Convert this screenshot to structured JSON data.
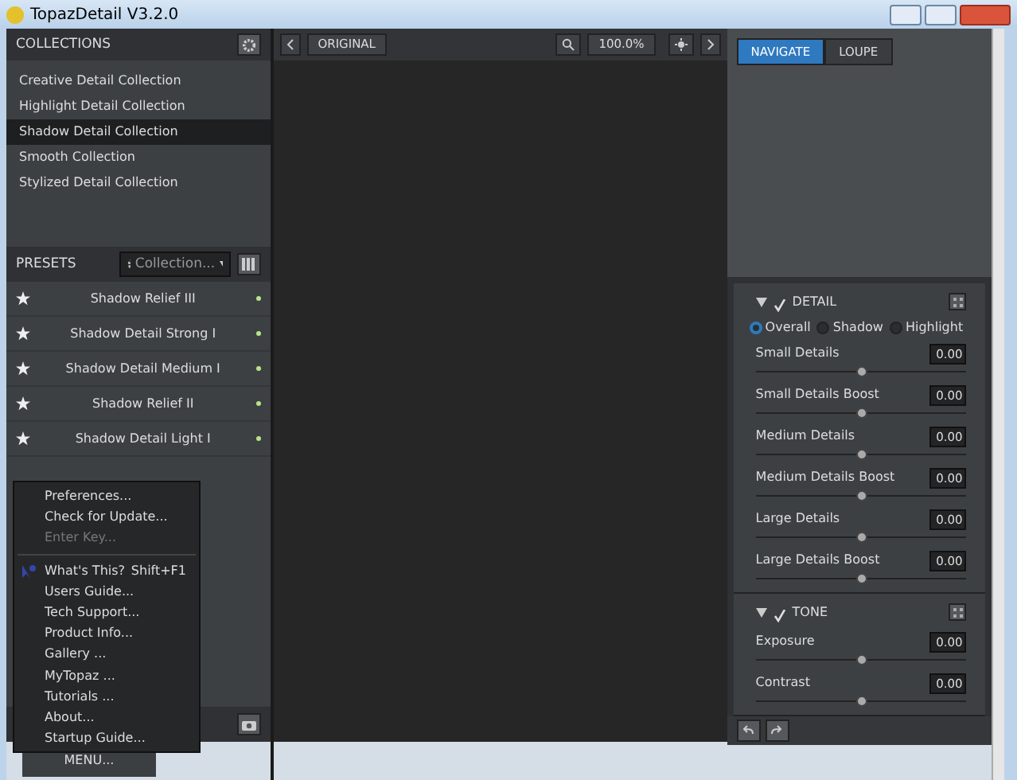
{
  "window": {
    "title": "TopazDetail V3.2.0"
  },
  "collections": {
    "title": "COLLECTIONS",
    "items": [
      {
        "label": "Creative Detail Collection",
        "selected": false
      },
      {
        "label": "Highlight Detail Collection",
        "selected": false
      },
      {
        "label": "Shadow Detail Collection",
        "selected": true
      },
      {
        "label": "Smooth Collection",
        "selected": false
      },
      {
        "label": "Stylized Detail Collection",
        "selected": false
      }
    ]
  },
  "presets": {
    "title": "PRESETS",
    "filter": "Collection...",
    "items": [
      {
        "label": "Shadow Relief III"
      },
      {
        "label": "Shadow Detail Strong I"
      },
      {
        "label": "Shadow Detail Medium I"
      },
      {
        "label": "Shadow Relief II"
      },
      {
        "label": "Shadow Detail Light I"
      }
    ]
  },
  "menu_button": "MENU...",
  "menu": [
    {
      "kind": "item",
      "label": "Preferences...",
      "disabled": false
    },
    {
      "kind": "item",
      "label": "Check for Update...",
      "disabled": false
    },
    {
      "kind": "item",
      "label": "Enter Key...",
      "disabled": true
    },
    {
      "kind": "separator"
    },
    {
      "kind": "help",
      "label": "What's This?",
      "shortcut": "Shift+F1",
      "disabled": false
    },
    {
      "kind": "item",
      "label": "Users Guide...",
      "disabled": false
    },
    {
      "kind": "item",
      "label": "Tech Support...",
      "disabled": false
    },
    {
      "kind": "item",
      "label": "Product Info...",
      "disabled": false
    },
    {
      "kind": "item",
      "label": "Gallery ...",
      "disabled": false
    },
    {
      "kind": "item",
      "label": "MyTopaz ...",
      "disabled": false
    },
    {
      "kind": "item",
      "label": "Tutorials ...",
      "disabled": false
    },
    {
      "kind": "item",
      "label": "About...",
      "disabled": false
    },
    {
      "kind": "item",
      "label": "Startup Guide...",
      "disabled": false
    }
  ],
  "toolbar": {
    "view_button": "ORIGINAL",
    "zoom": "100.0%"
  },
  "preview_tabs": [
    {
      "label": "NAVIGATE",
      "selected": true
    },
    {
      "label": "LOUPE",
      "selected": false
    }
  ],
  "sections": [
    {
      "title": "DETAIL",
      "expanded": true,
      "checked": true,
      "modes": [
        {
          "label": "Overall",
          "selected": true
        },
        {
          "label": "Shadow",
          "selected": false
        },
        {
          "label": "Highlight",
          "selected": false
        }
      ],
      "sliders": [
        {
          "label": "Small Details",
          "value": "0.00",
          "level": 0.5
        },
        {
          "label": "Small Details Boost",
          "value": "0.00",
          "level": 0.5
        },
        {
          "label": "Medium Details",
          "value": "0.00",
          "level": 0.5
        },
        {
          "label": "Medium Details Boost",
          "value": "0.00",
          "level": 0.5
        },
        {
          "label": "Large Details",
          "value": "0.00",
          "level": 0.5
        },
        {
          "label": "Large Details Boost",
          "value": "0.00",
          "level": 0.5
        }
      ]
    },
    {
      "title": "TONE",
      "expanded": true,
      "checked": true,
      "sliders": [
        {
          "label": "Exposure",
          "value": "0.00",
          "level": 0.5
        },
        {
          "label": "Contrast",
          "value": "0.00",
          "level": 0.5
        }
      ]
    }
  ]
}
